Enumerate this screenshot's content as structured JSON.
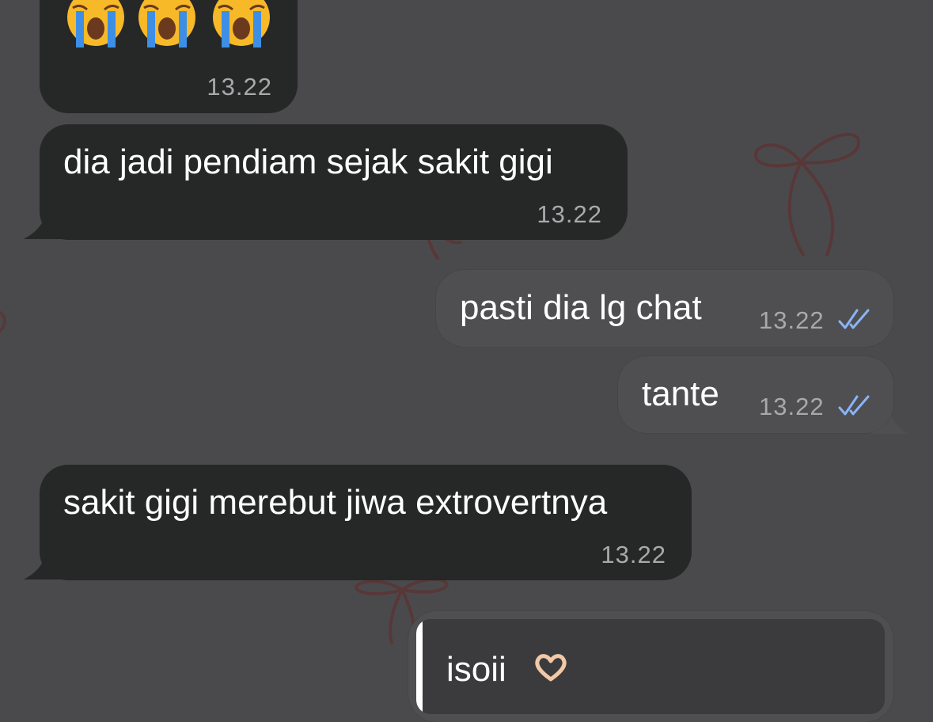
{
  "chat": {
    "messages": [
      {
        "direction": "incoming",
        "emojis": [
          "loudly-crying-face-icon",
          "loudly-crying-face-icon",
          "loudly-crying-face-icon"
        ],
        "time": "13.22"
      },
      {
        "direction": "incoming",
        "text": "dia jadi pendiam sejak sakit gigi",
        "time": "13.22"
      },
      {
        "direction": "outgoing",
        "text": "pasti dia lg chat",
        "time": "13.22",
        "status": "read-double-check-icon"
      },
      {
        "direction": "outgoing",
        "text": "tante",
        "time": "13.22",
        "status": "read-double-check-icon"
      },
      {
        "direction": "incoming",
        "text": "sakit gigi merebut jiwa extrovertnya",
        "time": "13.22"
      },
      {
        "direction": "outgoing",
        "text": "isoii",
        "emoji": "heart-hands-icon",
        "partial": true
      }
    ]
  },
  "colors": {
    "background": "#4a4a4c",
    "incoming_bubble": "#262727",
    "outgoing_bubble": "#4f4f51",
    "read_tick": "#8ab4f8",
    "text": "#ffffff",
    "timestamp": "#a9a9ac",
    "wallpaper_bow": "#5a3636"
  }
}
